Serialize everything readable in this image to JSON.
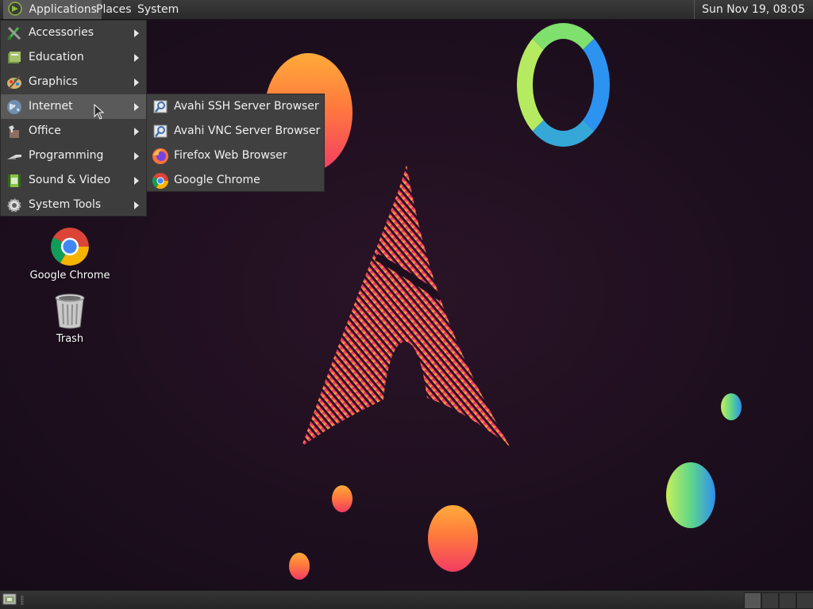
{
  "top_panel": {
    "applications_label": "Applications",
    "places_label": "Places",
    "system_label": "System",
    "clock": "Sun Nov 19, 08:05"
  },
  "applications_menu": {
    "items": [
      {
        "label": "Accessories",
        "icon": "accessories-icon"
      },
      {
        "label": "Education",
        "icon": "education-icon"
      },
      {
        "label": "Graphics",
        "icon": "graphics-icon"
      },
      {
        "label": "Internet",
        "icon": "internet-globe-icon",
        "active": true
      },
      {
        "label": "Office",
        "icon": "office-icon"
      },
      {
        "label": "Programming",
        "icon": "programming-icon"
      },
      {
        "label": "Sound & Video",
        "icon": "sound-video-icon"
      },
      {
        "label": "System Tools",
        "icon": "system-tools-gear-icon"
      }
    ]
  },
  "internet_submenu": {
    "items": [
      {
        "label": "Avahi SSH Server Browser",
        "icon": "avahi-icon"
      },
      {
        "label": "Avahi VNC Server Browser",
        "icon": "avahi-icon"
      },
      {
        "label": "Firefox Web Browser",
        "icon": "firefox-icon"
      },
      {
        "label": "Google Chrome",
        "icon": "chrome-icon"
      }
    ]
  },
  "desktop": {
    "icons": [
      {
        "label": "Google Chrome",
        "icon": "chrome-icon"
      },
      {
        "label": "Trash",
        "icon": "trash-icon"
      }
    ]
  },
  "colors": {
    "panel": "#2f2f2f",
    "menu_bg": "#3d3d3d",
    "menu_highlight": "#5a5a5a",
    "wallpaper": "#1e0f1f",
    "accent_pink": "#e8306b",
    "accent_orange": "#ffab3a"
  }
}
